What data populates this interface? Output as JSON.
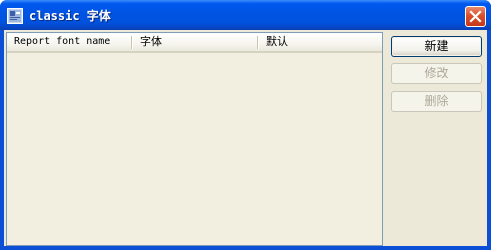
{
  "window": {
    "title": "classic 字体"
  },
  "listview": {
    "columns": [
      {
        "label": "Report font name"
      },
      {
        "label": "字体"
      },
      {
        "label": "默认"
      }
    ],
    "rows": []
  },
  "buttons": {
    "new_label": "新建",
    "edit_label": "修改",
    "delete_label": "删除"
  },
  "colors": {
    "titlebar": "#0054e3",
    "client_background": "#ece9d8",
    "list_background": "#f2efe1",
    "close_button": "#d8502c",
    "disabled_text": "#aca899"
  },
  "icons": {
    "app": "app-window-icon",
    "close": "close-icon"
  }
}
